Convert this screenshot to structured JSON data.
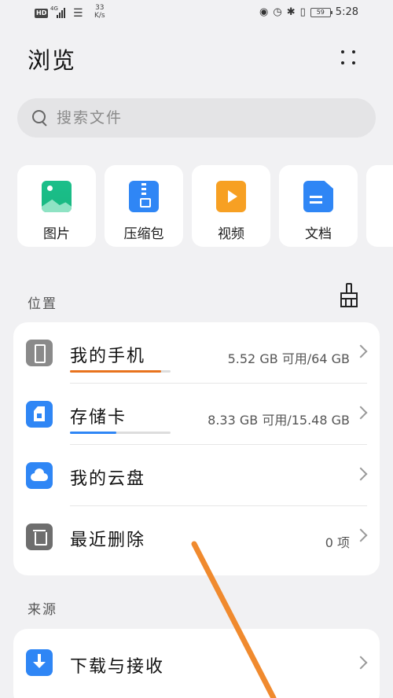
{
  "status_bar": {
    "hd": "HD",
    "network": "4G",
    "speed_value": "33",
    "speed_unit": "K/s",
    "battery": "59",
    "time": "5:28"
  },
  "header": {
    "title": "浏览",
    "more_icon": "more-dots-icon"
  },
  "search": {
    "placeholder": "搜索文件",
    "icon": "search-icon"
  },
  "categories": [
    {
      "label": "图片",
      "icon": "image-icon",
      "color": "#1bbf8a"
    },
    {
      "label": "压缩包",
      "icon": "archive-icon",
      "color": "#2f86f5"
    },
    {
      "label": "视频",
      "icon": "video-icon",
      "color": "#f7a023"
    },
    {
      "label": "文档",
      "icon": "document-icon",
      "color": "#2f86f5"
    }
  ],
  "locations": {
    "section_label": "位置",
    "clean_icon": "broom-icon",
    "items": [
      {
        "name": "我的手机",
        "info": "5.52 GB 可用/64 GB",
        "icon": "phone-icon",
        "usage_fraction": 0.91,
        "bar_color": "#e8731e"
      },
      {
        "name": "存储卡",
        "info": "8.33 GB 可用/15.48 GB",
        "icon": "sd-card-icon",
        "usage_fraction": 0.46,
        "bar_color": "#2f86f5"
      },
      {
        "name": "我的云盘",
        "info": "",
        "icon": "cloud-icon"
      },
      {
        "name": "最近删除",
        "info": "0 项",
        "icon": "trash-icon"
      }
    ]
  },
  "sources": {
    "section_label": "来源",
    "items": [
      {
        "name": "下载与接收",
        "icon": "download-icon"
      }
    ]
  },
  "colors": {
    "accent": "#2f86f5",
    "annotation_arrow": "#f08a2e"
  }
}
